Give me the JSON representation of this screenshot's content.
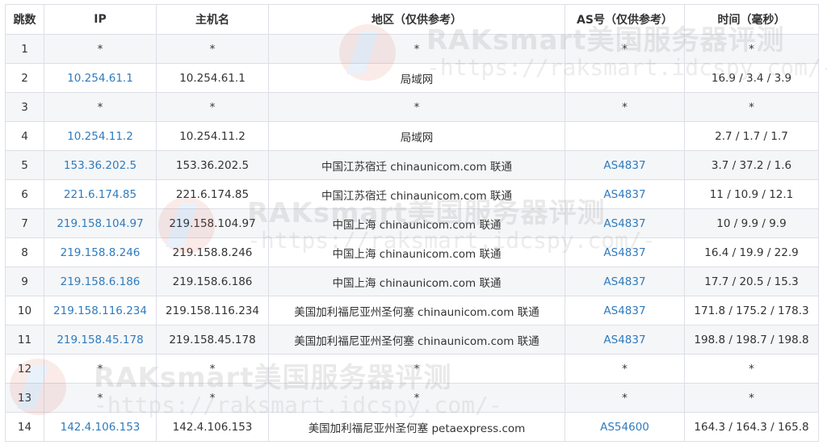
{
  "table": {
    "headers": {
      "hop": "跳数",
      "ip": "IP",
      "hostname": "主机名",
      "region": "地区（仅供参考）",
      "as": "AS号（仅供参考）",
      "time": "时间（毫秒）"
    },
    "rows": [
      {
        "hop": "1",
        "ip": "*",
        "hostname": "*",
        "region": "*",
        "as": "*",
        "time": "*"
      },
      {
        "hop": "2",
        "ip": "10.254.61.1",
        "hostname": "10.254.61.1",
        "region": "局域网",
        "as": "",
        "time": "16.9 / 3.4 / 3.9"
      },
      {
        "hop": "3",
        "ip": "*",
        "hostname": "*",
        "region": "*",
        "as": "*",
        "time": "*"
      },
      {
        "hop": "4",
        "ip": "10.254.11.2",
        "hostname": "10.254.11.2",
        "region": "局域网",
        "as": "",
        "time": "2.7 / 1.7 / 1.7"
      },
      {
        "hop": "5",
        "ip": "153.36.202.5",
        "hostname": "153.36.202.5",
        "region": "中国江苏宿迁 chinaunicom.com 联通",
        "as": "AS4837",
        "time": "3.7 / 37.2 / 1.6"
      },
      {
        "hop": "6",
        "ip": "221.6.174.85",
        "hostname": "221.6.174.85",
        "region": "中国江苏宿迁 chinaunicom.com 联通",
        "as": "AS4837",
        "time": "11 / 10.9 / 12.1"
      },
      {
        "hop": "7",
        "ip": "219.158.104.97",
        "hostname": "219.158.104.97",
        "region": "中国上海 chinaunicom.com 联通",
        "as": "AS4837",
        "time": "10 / 9.9 / 9.9"
      },
      {
        "hop": "8",
        "ip": "219.158.8.246",
        "hostname": "219.158.8.246",
        "region": "中国上海 chinaunicom.com 联通",
        "as": "AS4837",
        "time": "16.4 / 19.9 / 22.9"
      },
      {
        "hop": "9",
        "ip": "219.158.6.186",
        "hostname": "219.158.6.186",
        "region": "中国上海 chinaunicom.com 联通",
        "as": "AS4837",
        "time": "17.7 / 20.5 / 15.3"
      },
      {
        "hop": "10",
        "ip": "219.158.116.234",
        "hostname": "219.158.116.234",
        "region": "美国加利福尼亚州圣何塞 chinaunicom.com 联通",
        "as": "AS4837",
        "time": "171.8 / 175.2 / 178.3"
      },
      {
        "hop": "11",
        "ip": "219.158.45.178",
        "hostname": "219.158.45.178",
        "region": "美国加利福尼亚州圣何塞 chinaunicom.com 联通",
        "as": "AS4837",
        "time": "198.8 / 198.7 / 198.8"
      },
      {
        "hop": "12",
        "ip": "*",
        "hostname": "*",
        "region": "*",
        "as": "*",
        "time": "*"
      },
      {
        "hop": "13",
        "ip": "*",
        "hostname": "*",
        "region": "*",
        "as": "*",
        "time": "*"
      },
      {
        "hop": "14",
        "ip": "142.4.106.153",
        "hostname": "142.4.106.153",
        "region": "美国加利福尼亚州圣何塞 petaexpress.com",
        "as": "AS54600",
        "time": "164.3 / 164.3 / 165.8"
      }
    ]
  },
  "watermark": {
    "title": "RAKsmart美国服务器评测",
    "url": "-https://raksmart.idcspy.com/-"
  }
}
